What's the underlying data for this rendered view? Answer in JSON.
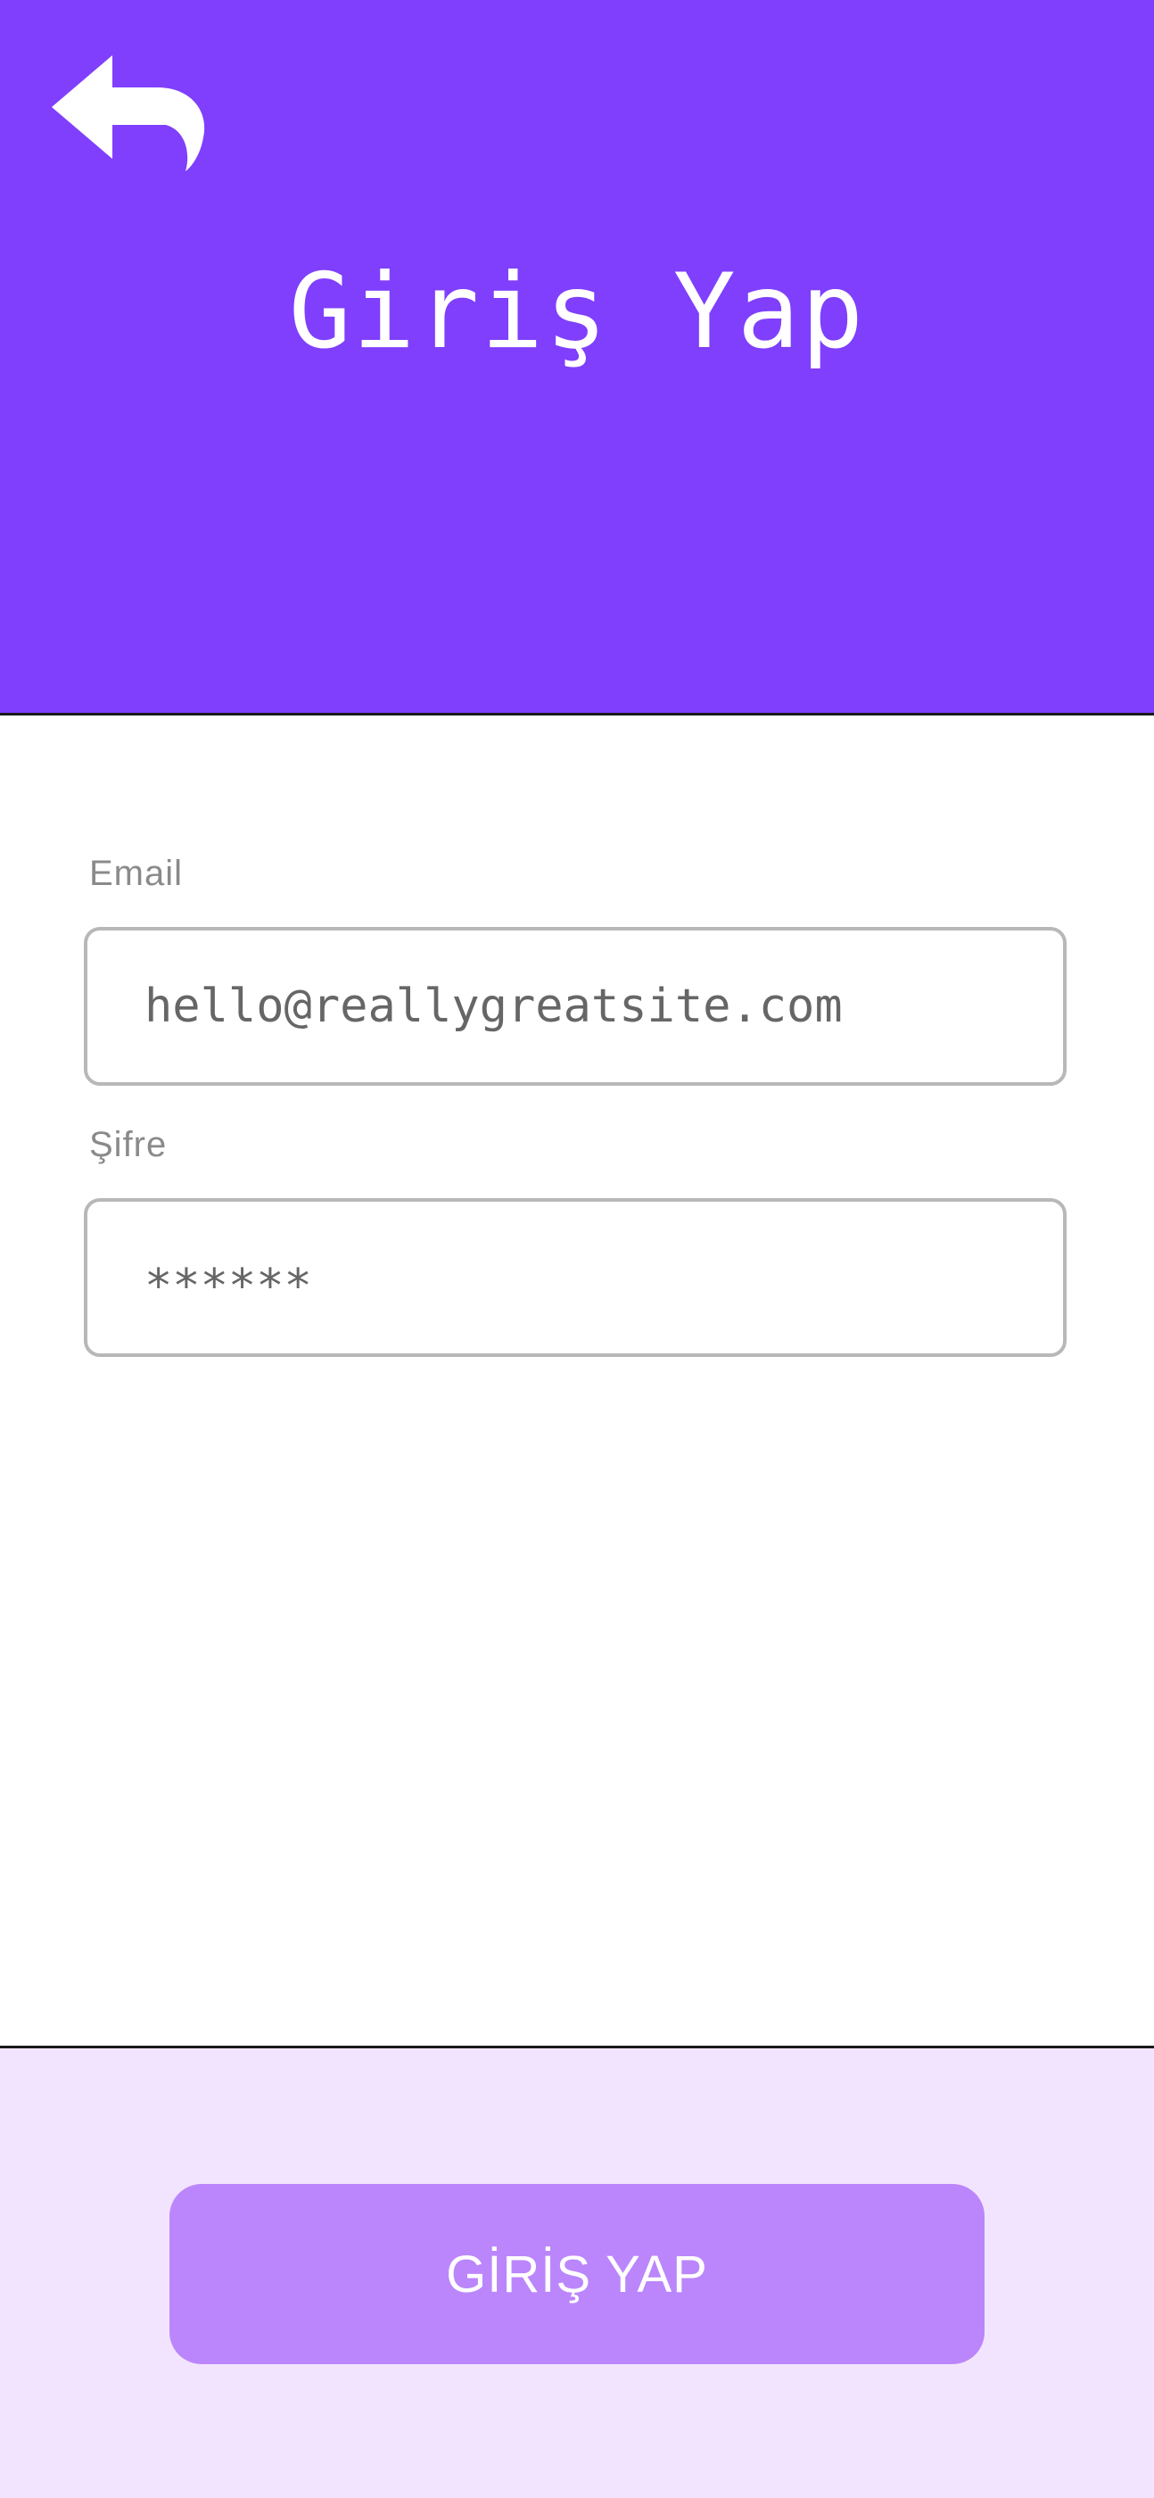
{
  "header": {
    "title": "Giriş Yap",
    "back_icon": "back-arrow-icon",
    "background_color": "#7f3ffd"
  },
  "form": {
    "email": {
      "label": "Email",
      "value": "hello@reallygreatsite.com"
    },
    "password": {
      "label": "Şifre",
      "value": "******"
    }
  },
  "footer": {
    "submit_label": "GİRİŞ YAP",
    "background_color": "#f2e4fe",
    "button_color": "#bb86fc"
  }
}
